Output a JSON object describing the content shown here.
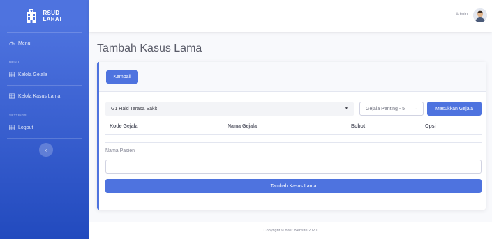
{
  "brand": {
    "line1": "RSUD",
    "line2": "LAHAT"
  },
  "sidebar": {
    "items": [
      {
        "label": "Menu",
        "icon": "gauge-icon"
      },
      {
        "heading": "MENU"
      },
      {
        "label": "Kelola Gejala",
        "icon": "table-icon"
      },
      {
        "label": "Kelola Kasus Lama",
        "icon": "table-icon"
      },
      {
        "heading": "SETTINGS"
      },
      {
        "label": "Logout",
        "icon": "table-icon"
      }
    ],
    "toggle_icon": "chevron-left-icon"
  },
  "topbar": {
    "user_name": "Admin"
  },
  "page": {
    "title": "Tambah Kasus Lama"
  },
  "card": {
    "back_button": "Kembali",
    "gejala_select": {
      "value": "G1 Haid Terasa Sakit"
    },
    "bobot_select": {
      "value": "Gejala Penting - 5"
    },
    "add_gejala_button": "Masukkan Gejala",
    "table": {
      "columns": [
        "Kode Gejala",
        "Nama Gejala",
        "Bobot",
        "Opsi"
      ],
      "rows": []
    },
    "pasien_label": "Nama Pasien",
    "pasien_value": "",
    "submit_button": "Tambah Kasus Lama"
  },
  "footer": {
    "text": "Copyright © Your Website 2020"
  },
  "colors": {
    "primary": "#4e73df",
    "sidebar_dark": "#224abe",
    "text": "#5a5c69"
  }
}
